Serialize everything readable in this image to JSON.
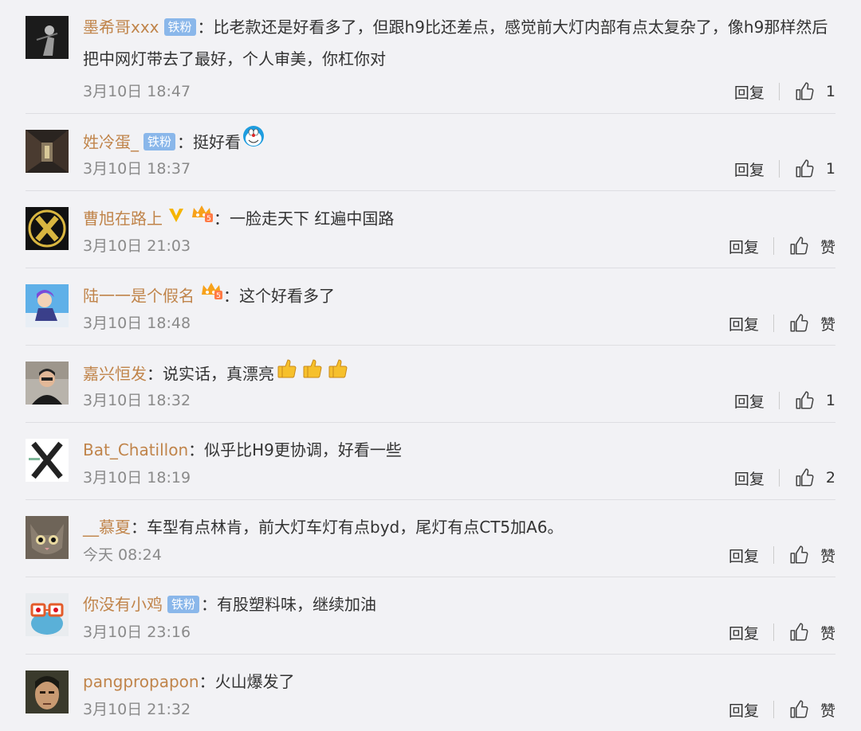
{
  "actions": {
    "reply_label": "回复"
  },
  "comments": [
    {
      "username": "墨希哥xxx",
      "badge": "铁粉",
      "text": "比老款还是好看多了，但跟h9比还差点，感觉前大灯内部有点太复杂了，像h9那样然后把中网灯带去了最好，个人审美，你杠你对",
      "time": "3月10日 18:47",
      "likes": "1",
      "avatar_icon": "dark-figure-avatar"
    },
    {
      "username": "姓冷蛋_",
      "badge": "铁粉",
      "text": "挺好看",
      "emoji": "doraemon-emoji",
      "time": "3月10日 18:37",
      "likes": "1",
      "avatar_icon": "corridor-avatar"
    },
    {
      "username": "曹旭在路上",
      "vip_level": "5",
      "text": "一脸走天下 红遍中国路",
      "time": "3月10日 21:03",
      "likes": "赞",
      "avatar_icon": "x-logo-avatar"
    },
    {
      "username": "陆一一是个假名",
      "vip_level": "5",
      "text": "这个好看多了",
      "time": "3月10日 18:48",
      "likes": "赞",
      "avatar_icon": "anime-avatar"
    },
    {
      "username": "嘉兴恒发",
      "text": "说实话，真漂亮",
      "emoji": "thumbs-up-emoji",
      "emoji_count": 3,
      "time": "3月10日 18:32",
      "likes": "1",
      "avatar_icon": "person-avatar"
    },
    {
      "username": "Bat_Chatillon",
      "text": "似乎比H9更协调，好看一些",
      "time": "3月10日 18:19",
      "likes": "2",
      "avatar_icon": "x-letter-avatar"
    },
    {
      "username": "__慕夏",
      "text": "车型有点林肯，前大灯车灯有点byd，尾灯有点CT5加A6。",
      "time": "今天 08:24",
      "likes": "赞",
      "avatar_icon": "cat-avatar"
    },
    {
      "username": "你没有小鸡",
      "badge": "铁粉",
      "text": "有股塑料味，继续加油",
      "time": "3月10日 23:16",
      "likes": "赞",
      "avatar_icon": "frog-avatar"
    },
    {
      "username": "pangpropapon",
      "text": "火山爆发了",
      "time": "3月10日 21:32",
      "likes": "赞",
      "avatar_icon": "face-avatar"
    }
  ]
}
